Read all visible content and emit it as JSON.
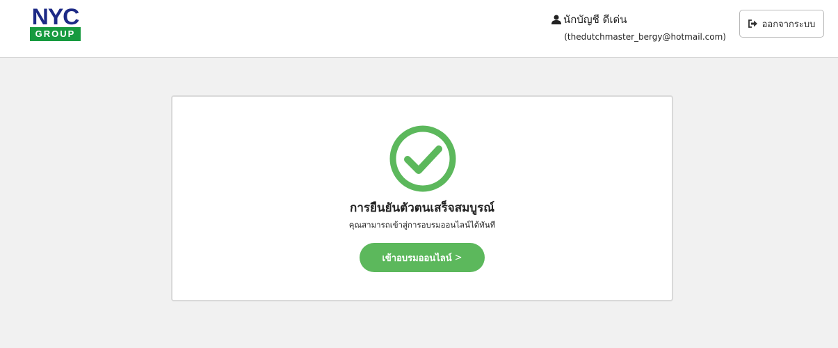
{
  "header": {
    "logo": {
      "top_text": "NYC",
      "bottom_text": "GROUP"
    },
    "user": {
      "icon": "user-icon",
      "name": "นักบัญชี ดีเด่น",
      "email": "(thedutchmaster_bergy@hotmail.com)"
    },
    "logout": {
      "icon": "sign-out-icon",
      "label": "ออกจากระบบ"
    }
  },
  "card": {
    "status_icon": "check-circle-icon",
    "title": "การยืนยันตัวตนเสร็จสมบูรณ์",
    "subtitle": "คุณสามารถเข้าสู่การอบรมออนไลน์ได้ทันที",
    "button": {
      "label": "เข้าอบรมออนไลน์",
      "arrow": ">"
    }
  },
  "colors": {
    "brand_blue": "#1d2a86",
    "brand_green": "#179a3f",
    "success_green": "#5cb85c",
    "page_background": "#f1f1f1"
  }
}
